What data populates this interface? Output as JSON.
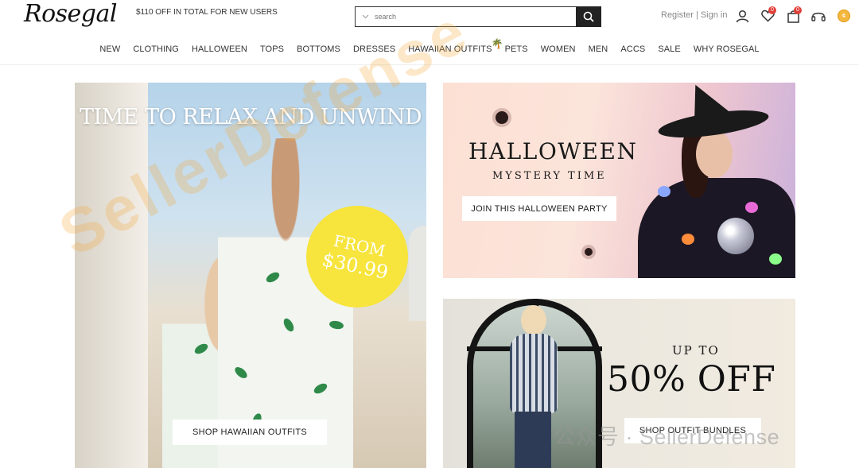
{
  "brand": {
    "logo_text": "Rosegal"
  },
  "promo": {
    "text": "$110 OFF IN TOTAL FOR NEW USERS"
  },
  "search": {
    "placeholder": "search"
  },
  "account": {
    "register": "Register",
    "separator": "|",
    "signin": "Sign in"
  },
  "header_icons": {
    "wishlist_count": "0",
    "cart_count": "0",
    "icons": [
      "user-icon",
      "heart-icon",
      "bag-icon",
      "headset-icon",
      "coin-icon"
    ]
  },
  "nav": {
    "items": [
      "NEW",
      "CLOTHING",
      "HALLOWEEN",
      "TOPS",
      "BOTTOMS",
      "DRESSES",
      "HAWAIIAN OUTFITS",
      "PETS",
      "WOMEN",
      "MEN",
      "ACCS",
      "SALE",
      "WHY ROSEGAL"
    ]
  },
  "banners": {
    "hawaii": {
      "title": "TIME TO RELAX AND UNWIND",
      "sticker_line1": "FROM",
      "sticker_line2": "$30.99",
      "cta": "SHOP HAWAIIAN OUTFITS"
    },
    "halloween": {
      "title": "HALLOWEEN",
      "subtitle": "MYSTERY TIME",
      "cta": "JOIN THIS HALLOWEEN PARTY"
    },
    "sale": {
      "line1": "UP TO",
      "line2": "50% OFF",
      "cta": "SHOP OUTFIT BUNDLES"
    }
  },
  "watermarks": {
    "diagonal": "SellerDefense",
    "bottom": "公众号 · SellerDefense"
  },
  "colors": {
    "badge": "#e0413a",
    "sticker": "#f7e43c",
    "coin": "#f4b740"
  }
}
